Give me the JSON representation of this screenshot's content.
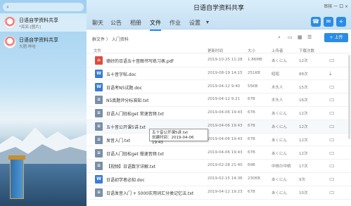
{
  "sidebar": {
    "chats": [
      {
        "name": "日语自学资料共享",
        "preview": "*亮亮:[图片]",
        "time": ""
      },
      {
        "name": "日语自学资料共享",
        "preview": "大肥:哗哈",
        "time": ""
      }
    ]
  },
  "window": {
    "title": "日语自学资料共享",
    "controls": "审核  一  口  ×"
  },
  "tabs": [
    "聊天",
    "公告",
    "相册",
    "文件",
    "作业",
    "设置"
  ],
  "tab_more": "▾",
  "breadcrumb": "群文件 〉 入门资料",
  "upload_label": "+ 上传",
  "columns": {
    "name": "文件",
    "time": "更新时间",
    "size": "大小",
    "uploader": "上传者",
    "downloads": "下载次数"
  },
  "files": [
    {
      "icon": "pdf",
      "name": "德好的日语五十音图书写练习表.pdf",
      "time": "2019-10-25 11:28",
      "size": "1.86MB",
      "uploader": "あくにん",
      "downloads": "12次"
    },
    {
      "icon": "doc",
      "name": "五十音字帖.doc",
      "time": "2019-08-19 14:15",
      "size": "251KB",
      "uploader": "昭昭",
      "downloads": "88次"
    },
    {
      "icon": "doc",
      "name": "日语考N5试题.doc",
      "time": "2019-04-12 9:40",
      "size": "55KB",
      "uploader": "木头人",
      "downloads": "15次"
    },
    {
      "icon": "txt",
      "name": "N5真题评分标准知.txt",
      "time": "2019-04-12 9:21",
      "size": "67B",
      "uploader": "木头人",
      "downloads": "16次"
    },
    {
      "icon": "txt",
      "name": "日语入门轻松get 常速音频.txt",
      "time": "2019-04-06 19:43",
      "size": "67B",
      "uploader": "あくにん",
      "downloads": "12次"
    },
    {
      "icon": "txt",
      "name": "五十音公开课5讲.txt",
      "time": "2019-04-06 19:43",
      "size": "67B",
      "uploader": "あくにん",
      "downloads": "12次"
    },
    {
      "icon": "txt",
      "name": "发音入门.txt",
      "time": "2019-04-06 19:43",
      "size": "67B",
      "uploader": "あくにん",
      "downloads": "12次"
    },
    {
      "icon": "txt",
      "name": "日语入门轻松get 慢速音频.txt",
      "time": "2019-04-06 19:43",
      "size": "67B",
      "uploader": "あくにん",
      "downloads": "12次"
    },
    {
      "icon": "txt",
      "name": "【视频】日语数字详解.txt",
      "time": "2019-02-28 21:40",
      "size": "69B",
      "uploader": "中桃の中桃",
      "downloads": "17次"
    },
    {
      "icon": "doc",
      "name": "日语初学者必知.doc",
      "time": "2019-02-15 14:36",
      "size": "230KB",
      "uploader": "あくにん",
      "downloads": "9次"
    },
    {
      "icon": "txt",
      "name": "日语发音入门 + 5000实用词汇分类记忆法.txt",
      "time": "2019-04-12 19:23",
      "size": "67B",
      "uploader": "あくにん",
      "downloads": "10次"
    }
  ],
  "tooltip": {
    "line1": "五十音公开课5讲.txt",
    "line2": "创建时间：2019-04-06 19:43"
  },
  "colors": {
    "accent": "#2b8ce6",
    "pdf": "#e04b3c",
    "doc": "#3a7bd5",
    "txt": "#7a8ea6"
  }
}
